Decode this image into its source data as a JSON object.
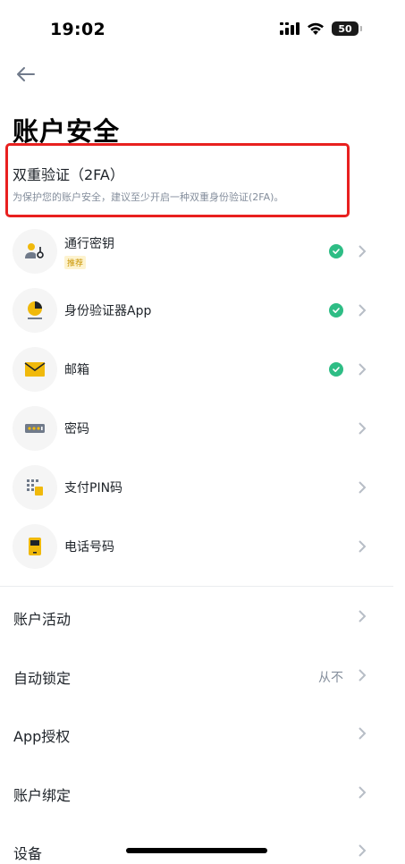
{
  "status_bar": {
    "time": "19:02",
    "battery": "50"
  },
  "header": {
    "title": "账户安全"
  },
  "two_factor": {
    "title": "双重验证（2FA）",
    "description": "为保护您的账户安全，建议至少开启一种双重身份验证(2FA)。"
  },
  "methods": [
    {
      "label": "通行密钥",
      "badge": "推荐",
      "verified": true,
      "icon": "passkey-icon"
    },
    {
      "label": "身份验证器App",
      "verified": true,
      "icon": "authenticator-icon"
    },
    {
      "label": "邮箱",
      "verified": true,
      "icon": "mail-icon"
    },
    {
      "label": "密码",
      "verified": false,
      "icon": "password-icon"
    },
    {
      "label": "支付PIN码",
      "verified": false,
      "icon": "pin-icon"
    },
    {
      "label": "电话号码",
      "verified": false,
      "icon": "phone-icon"
    }
  ],
  "settings": [
    {
      "label": "账户活动"
    },
    {
      "label": "自动锁定",
      "value": "从不"
    },
    {
      "label": "App授权"
    },
    {
      "label": "账户绑定"
    },
    {
      "label": "设备"
    }
  ],
  "colors": {
    "accent": "#f0b90b",
    "success": "#2ebd85",
    "highlight": "#e8201f",
    "text_primary": "#1e2329",
    "text_secondary": "#848e9c"
  }
}
